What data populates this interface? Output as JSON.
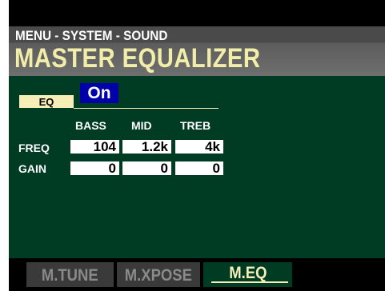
{
  "header": {
    "breadcrumb": "MENU - SYSTEM - SOUND",
    "title": "MASTER EQUALIZER"
  },
  "eq": {
    "label": "EQ",
    "value": "On"
  },
  "table": {
    "columns": [
      "BASS",
      "MID",
      "TREB"
    ],
    "rows": [
      {
        "label": "FREQ",
        "values": [
          "104",
          "1.2k",
          "4k"
        ]
      },
      {
        "label": "GAIN",
        "values": [
          "0",
          "0",
          "0"
        ]
      }
    ]
  },
  "tabs": [
    {
      "label": "M.TUNE",
      "active": false
    },
    {
      "label": "M.XPOSE",
      "active": false
    },
    {
      "label": "M.EQ",
      "active": true
    }
  ],
  "colors": {
    "background": "#003b24",
    "accent": "#f6eeb6",
    "selection": "#0000aa"
  }
}
